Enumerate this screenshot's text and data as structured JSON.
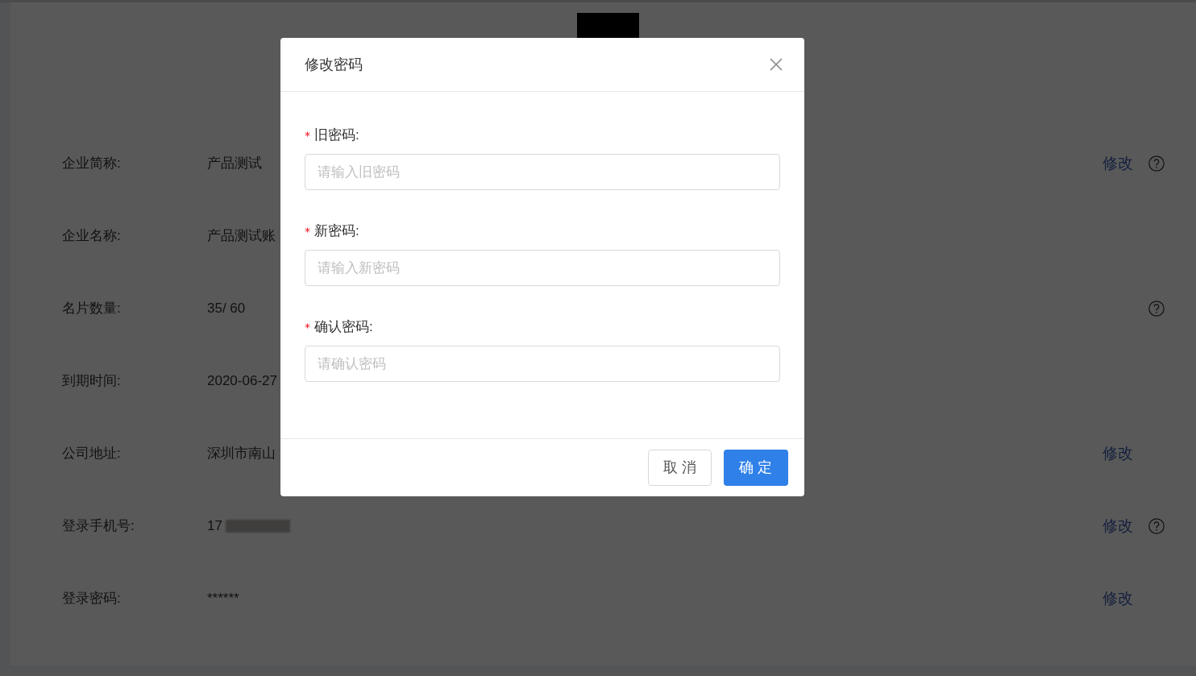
{
  "rows": [
    {
      "label": "企业简称:",
      "value": "产品测试",
      "action": "修改",
      "help": true
    },
    {
      "label": "企业名称:",
      "value": "产品测试账",
      "help": false
    },
    {
      "label": "名片数量:",
      "value": "35/ 60",
      "help": true
    },
    {
      "label": "到期时间:",
      "value": "2020-06-27",
      "help": false
    },
    {
      "label": "公司地址:",
      "value": "深圳市南山",
      "action": "修改",
      "help": false
    },
    {
      "label": "登录手机号:",
      "value": "17",
      "redacted": true,
      "action": "修改",
      "help": true
    },
    {
      "label": "登录密码:",
      "value": "******",
      "action": "修改",
      "help": false
    }
  ],
  "dialog": {
    "title": "修改密码",
    "fields": [
      {
        "label": "旧密码:",
        "required": true,
        "placeholder": "请输入旧密码"
      },
      {
        "label": "新密码:",
        "required": true,
        "placeholder": "请输入新密码"
      },
      {
        "label": "确认密码:",
        "required": true,
        "placeholder": "请确认密码"
      }
    ],
    "buttons": [
      {
        "label": "取 消",
        "kind": "default"
      },
      {
        "label": "确 定",
        "kind": "primary"
      }
    ]
  }
}
